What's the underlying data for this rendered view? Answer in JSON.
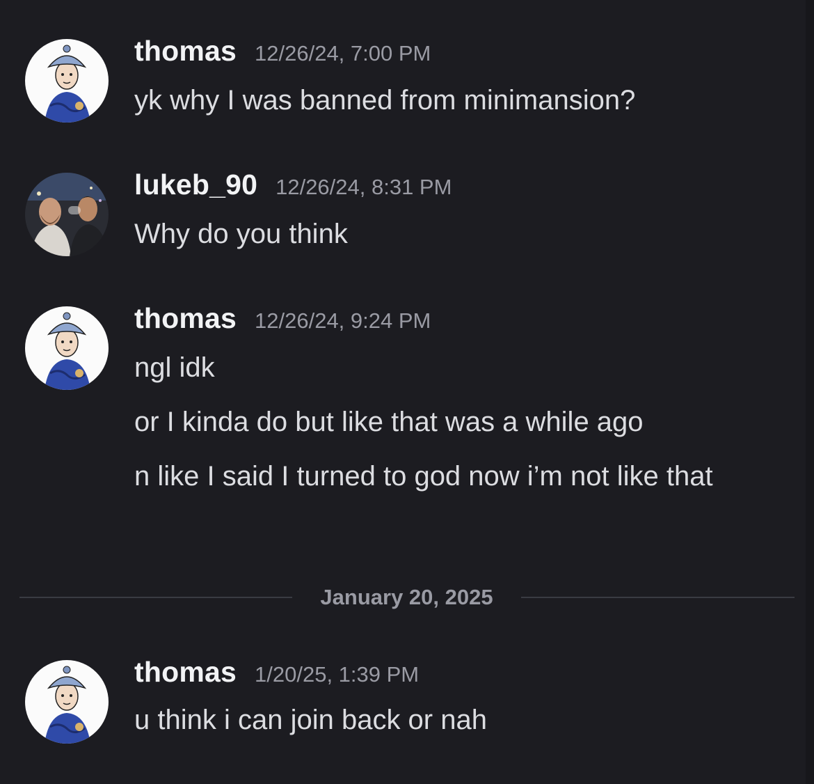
{
  "messages": [
    {
      "author": "thomas",
      "timestamp": "12/26/24, 7:00 PM",
      "lines": [
        "yk why I was banned from minimansion?"
      ]
    },
    {
      "author": "lukeb_90",
      "timestamp": "12/26/24, 8:31 PM",
      "lines": [
        "Why do you think"
      ]
    },
    {
      "author": "thomas",
      "timestamp": "12/26/24, 9:24 PM",
      "lines": [
        "ngl idk",
        "or I kinda do but like that was a while ago",
        "n like I said I turned to god now i’m not like that"
      ]
    },
    {
      "author": "thomas",
      "timestamp": "1/20/25, 1:39 PM",
      "lines": [
        "u think i can join back or nah"
      ]
    }
  ],
  "date_divider": "January 20, 2025",
  "colors": {
    "background": "#1c1c21",
    "username": "#f2f3f5",
    "message_text": "#dcdde1",
    "timestamp": "#9a9ba4",
    "divider_line": "#3a3b42"
  }
}
